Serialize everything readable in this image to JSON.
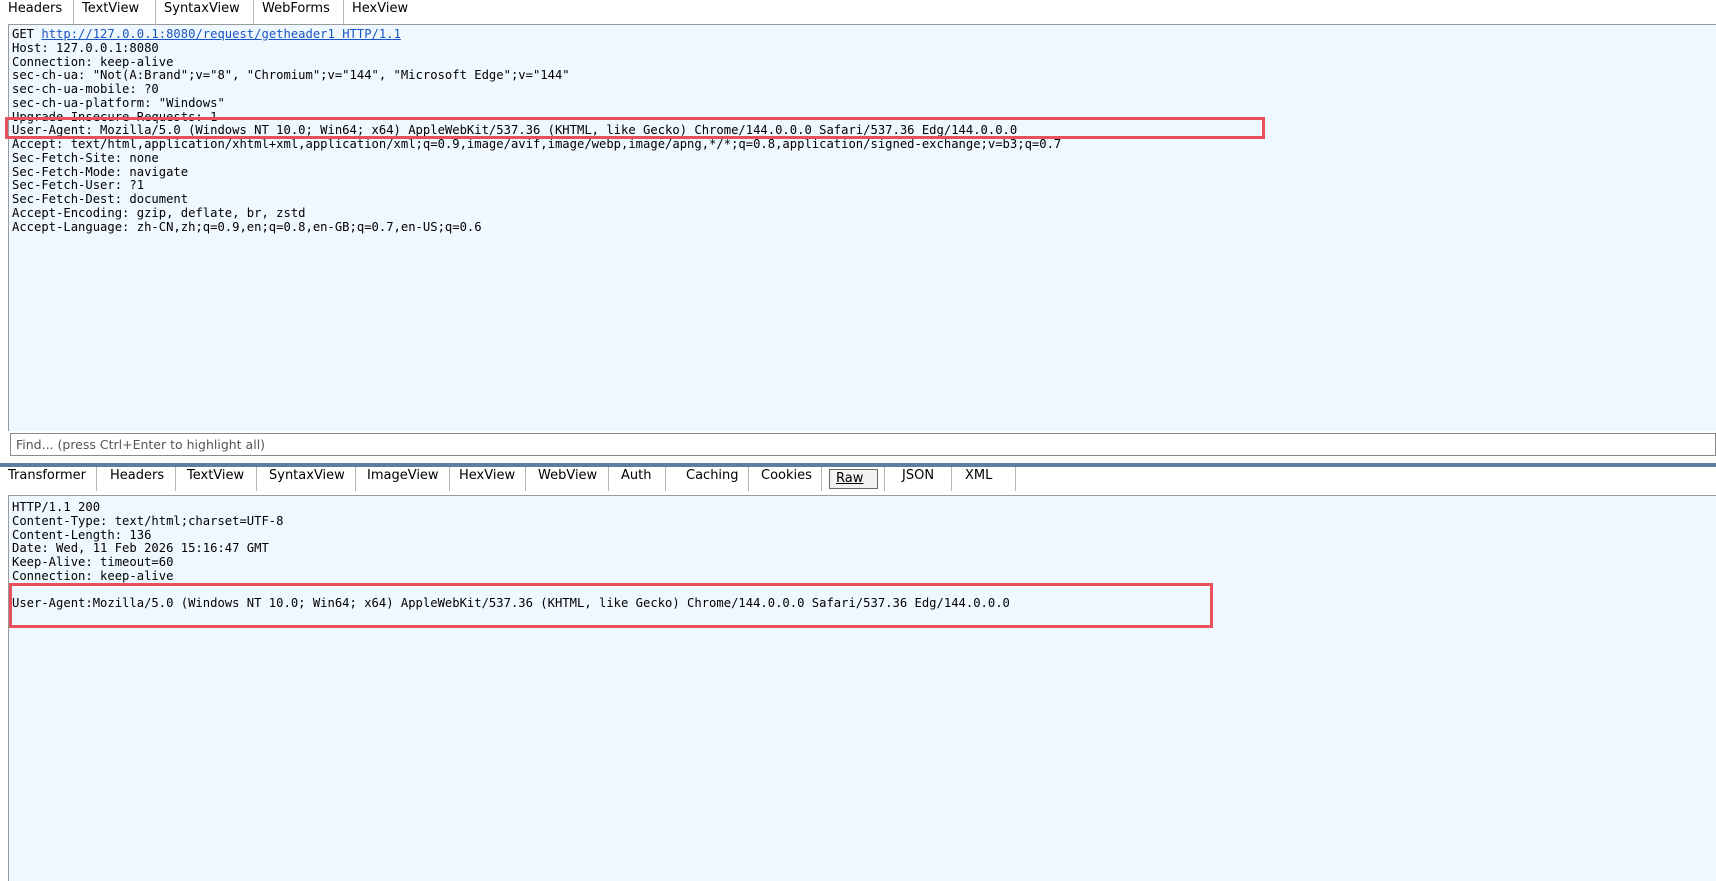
{
  "request_tabs": [
    "Headers",
    "TextView",
    "SyntaxView",
    "WebForms",
    "HexView"
  ],
  "request": {
    "method": "GET",
    "url": "http://127.0.0.1:8080/request/getheader1",
    "protocol": "HTTP/1.1",
    "lines_before_ua": [
      "Host: 127.0.0.1:8080",
      "Connection: keep-alive",
      "sec-ch-ua: \"Not(A:Brand\";v=\"8\", \"Chromium\";v=\"144\", \"Microsoft Edge\";v=\"144\"",
      "sec-ch-ua-mobile: ?0",
      "sec-ch-ua-platform: \"Windows\"",
      "Upgrade-Insecure-Requests: 1"
    ],
    "user_agent_line": "User-Agent: Mozilla/5.0 (Windows NT 10.0; Win64; x64) AppleWebKit/537.36 (KHTML, like Gecko) Chrome/144.0.0.0 Safari/537.36 Edg/144.0.0.0",
    "lines_after_ua": [
      "Accept: text/html,application/xhtml+xml,application/xml;q=0.9,image/avif,image/webp,image/apng,*/*;q=0.8,application/signed-exchange;v=b3;q=0.7",
      "Sec-Fetch-Site: none",
      "Sec-Fetch-Mode: navigate",
      "Sec-Fetch-User: ?1",
      "Sec-Fetch-Dest: document",
      "Accept-Encoding: gzip, deflate, br, zstd",
      "Accept-Language: zh-CN,zh;q=0.9,en;q=0.8,en-GB;q=0.7,en-US;q=0.6"
    ]
  },
  "find": {
    "placeholder": "Find... (press Ctrl+Enter to highlight all)"
  },
  "response_tabs": [
    "Transformer",
    "Headers",
    "TextView",
    "SyntaxView",
    "ImageView",
    "HexView",
    "WebView",
    "Auth",
    "Caching",
    "Cookies",
    "Raw",
    "JSON",
    "XML"
  ],
  "response_selected_tab": "Raw",
  "response": {
    "header_lines": [
      "HTTP/1.1 200",
      "Content-Type: text/html;charset=UTF-8",
      "Content-Length: 136",
      "Date: Wed, 11 Feb 2026 15:16:47 GMT",
      "Keep-Alive: timeout=60",
      "Connection: keep-alive"
    ],
    "body_line": "User-Agent:Mozilla/5.0 (Windows NT 10.0; Win64; x64) AppleWebKit/537.36 (KHTML, like Gecko) Chrome/144.0.0.0 Safari/537.36 Edg/144.0.0.0"
  },
  "colors": {
    "highlight": "#e8505b",
    "pane_bg": "#f0f8ff",
    "link": "#1a56c4"
  }
}
